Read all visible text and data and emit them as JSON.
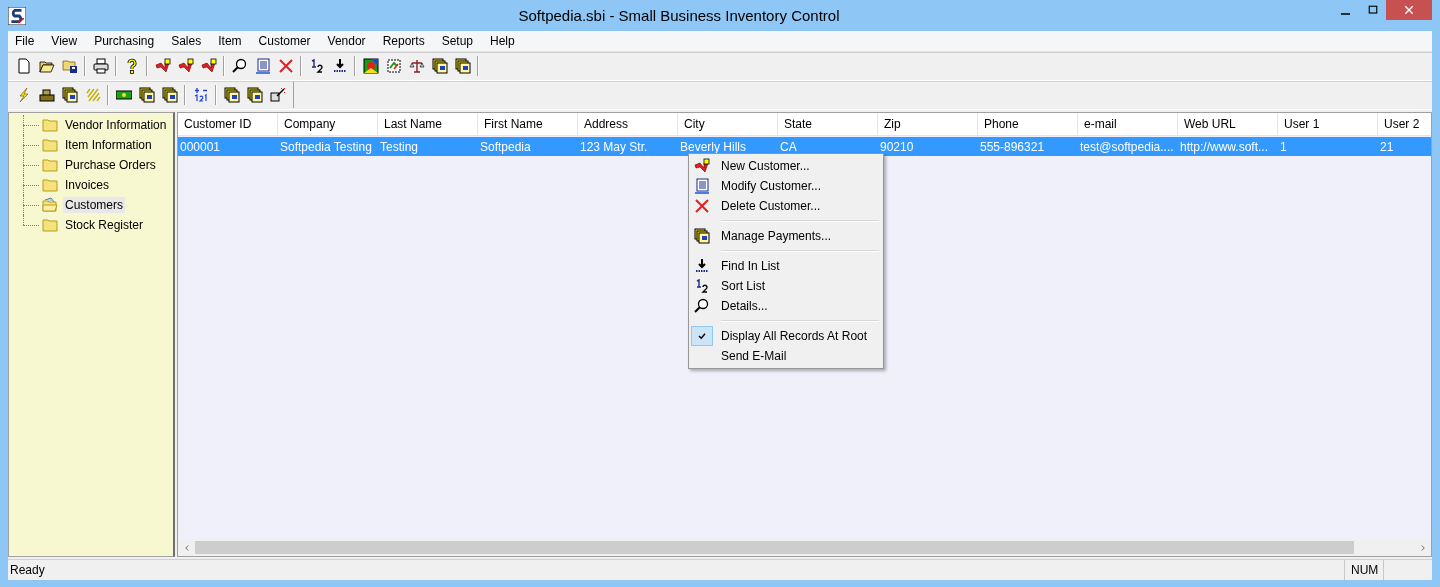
{
  "window": {
    "title": "Softpedia.sbi - Small Business Inventory Control"
  },
  "menu_bar": [
    "File",
    "View",
    "Purchasing",
    "Sales",
    "Item",
    "Customer",
    "Vendor",
    "Reports",
    "Setup",
    "Help"
  ],
  "sidebar": {
    "items": [
      {
        "label": "Vendor Information",
        "selected": false
      },
      {
        "label": "Item Information",
        "selected": false
      },
      {
        "label": "Purchase Orders",
        "selected": false
      },
      {
        "label": "Invoices",
        "selected": false
      },
      {
        "label": "Customers",
        "selected": true
      },
      {
        "label": "Stock Register",
        "selected": false
      }
    ]
  },
  "table": {
    "columns": [
      "Customer ID",
      "Company",
      "Last Name",
      "First Name",
      "Address",
      "City",
      "State",
      "Zip",
      "Phone",
      "e-mail",
      "Web URL",
      "User 1",
      "User 2"
    ],
    "rows": [
      {
        "selected": true,
        "cells": [
          "000001",
          "Softpedia Testing",
          "Testing",
          "Softpedia",
          "123 May Str.",
          "Beverly Hills",
          "CA",
          "90210",
          "555-896321",
          "test@softpedia....",
          "http://www.soft...",
          "1",
          "21"
        ]
      }
    ]
  },
  "context_menu": {
    "items": [
      {
        "kind": "item",
        "label": "New Customer...",
        "checked": false
      },
      {
        "kind": "item",
        "label": "Modify Customer...",
        "checked": false
      },
      {
        "kind": "item",
        "label": "Delete Customer...",
        "checked": false
      },
      {
        "kind": "separator"
      },
      {
        "kind": "item",
        "label": "Manage Payments...",
        "checked": false
      },
      {
        "kind": "separator"
      },
      {
        "kind": "item",
        "label": "Find In List",
        "checked": false
      },
      {
        "kind": "item",
        "label": "Sort List",
        "checked": false
      },
      {
        "kind": "item",
        "label": "Details...",
        "checked": false
      },
      {
        "kind": "separator"
      },
      {
        "kind": "item",
        "label": "Display All Records At Root",
        "checked": true
      },
      {
        "kind": "item",
        "label": "Send E-Mail",
        "checked": false
      }
    ]
  },
  "status_bar": {
    "message": "Ready",
    "indicator": "NUM"
  }
}
